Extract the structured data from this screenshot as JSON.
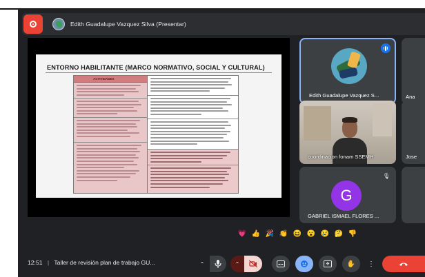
{
  "presenter_bar": {
    "text": "Edith Guadalupe Vazquez Silva (Presentar)",
    "record_icon": "record-icon"
  },
  "slide": {
    "title": "ENTORNO HABILITANTE (MARCO NORMATIVO, SOCIAL Y CULTURAL)",
    "table_left_header": "ACTIVIDADES"
  },
  "participants": [
    {
      "name": "Edith Guadalupe Vazquez S...",
      "state": "speaking"
    },
    {
      "name": "coordinacion fonam SSEMH"
    },
    {
      "name": "GABRIEL ISMAEL FLORES ...",
      "initial": "G",
      "color": "#9334e6"
    }
  ],
  "edge_participants": [
    {
      "name": "Ana"
    },
    {
      "name": "Jose"
    }
  ],
  "reactions": [
    "💗",
    "👍",
    "🎉",
    "👏",
    "😆",
    "😮",
    "😢",
    "🤔",
    "👎"
  ],
  "bottom": {
    "time": "12:51",
    "separator": "|",
    "meeting_title": "Taller de revisión plan de trabajo GU...",
    "controls": [
      "chevron-up-icon",
      "mic-icon",
      "chevron-up-icon",
      "camera-off-icon",
      "captions-icon",
      "emoji-icon",
      "present-icon",
      "raise-hand-icon",
      "more-icon",
      "end-call-icon"
    ]
  },
  "colors": {
    "background": "#202124",
    "tile": "#3c4043",
    "accent": "#8ab4f8",
    "end_call": "#ea4335",
    "record": "#ea4335"
  }
}
